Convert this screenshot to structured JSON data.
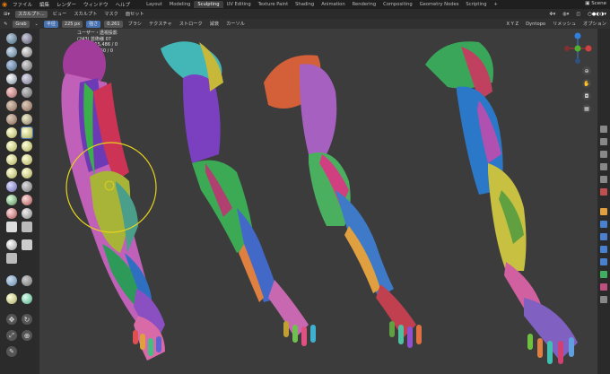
{
  "top_menu": {
    "items": [
      "ファイル",
      "編集",
      "レンダー",
      "ウィンドウ",
      "ヘルプ"
    ],
    "workspaces": [
      "Layout",
      "Modeling",
      "Sculpting",
      "UV Editing",
      "Texture Paint",
      "Shading",
      "Animation",
      "Rendering",
      "Compositing",
      "Geometry Nodes",
      "Scripting",
      "+"
    ],
    "active_workspace": "Sculpting",
    "scene": "Scene"
  },
  "header": {
    "mode": "スカルプト...",
    "menus": [
      "ビュー",
      "スカルプト",
      "マスク",
      "面セット"
    ],
    "right": [
      "Dyntopo",
      "リメッシュ",
      "オプション"
    ],
    "axis": "X Y Z"
  },
  "tool_settings": {
    "brush": "Grab",
    "radius_label": "半径",
    "radius_value": "225 px",
    "strength_label": "強さ",
    "strength_value": "0.261",
    "dropdowns": [
      "ブラシ",
      "テクスチャ",
      "ストローク",
      "減衰",
      "カーソル"
    ]
  },
  "viewport": {
    "stats": [
      "ユーザー・透視投影",
      "(243) 芸術様 07",
      "頂点          4,315,486 / 0",
      "面             4,315,360 / 0"
    ]
  },
  "colors": {
    "accent": "#4772b3",
    "brush_circle": "#e6d21e",
    "active_ws": "#3d3d3d"
  }
}
